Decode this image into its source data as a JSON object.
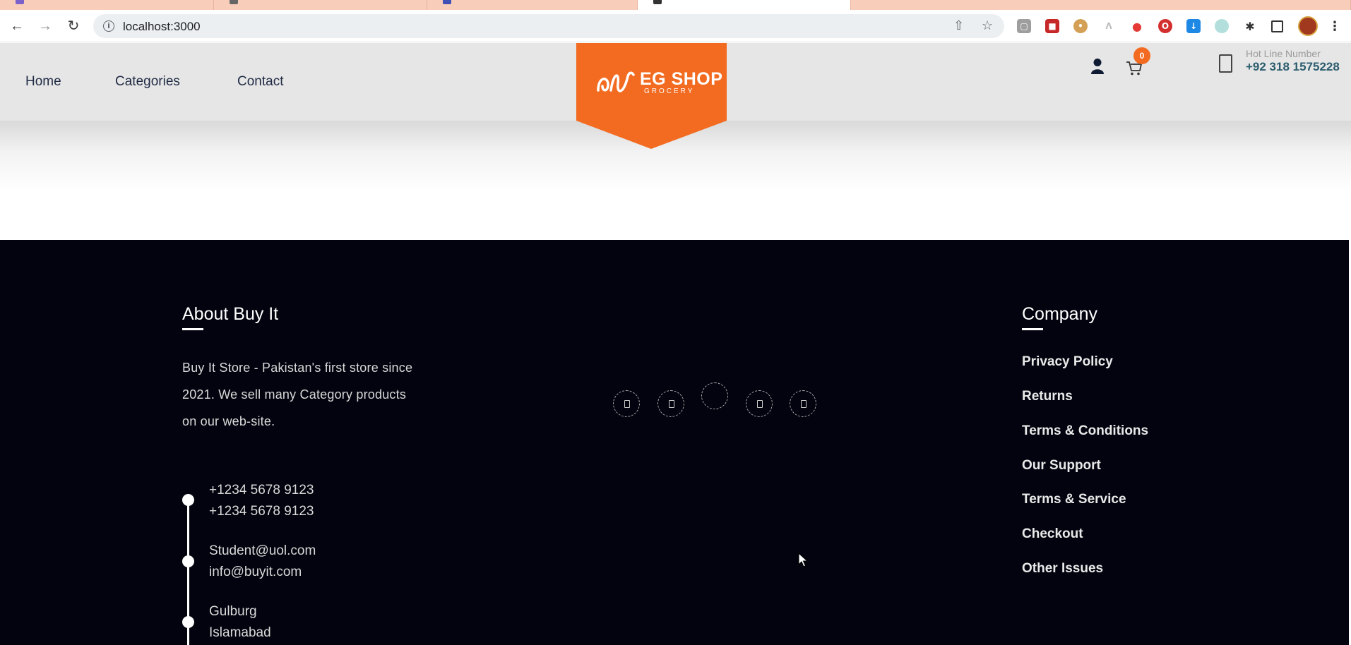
{
  "browser": {
    "url": "localhost:3000"
  },
  "header": {
    "nav": [
      {
        "label": "Home"
      },
      {
        "label": "Categories"
      },
      {
        "label": "Contact"
      }
    ],
    "logo": {
      "title": "EG SHOP",
      "subtitle": "GROCERY"
    },
    "cart_count": "0",
    "hotline": {
      "label": "Hot Line Number",
      "number": "+92 318 1575228"
    }
  },
  "footer": {
    "about": {
      "heading": "About Buy It",
      "description": "Buy It Store - Pakistan's first store since 2021. We sell many Category products on our web-site.",
      "phones": [
        "+1234 5678 9123",
        "+1234 5678 9123"
      ],
      "emails": [
        "Student@uol.com",
        "info@buyit.com"
      ],
      "address": [
        "Gulburg",
        "Islamabad"
      ]
    },
    "company": {
      "heading": "Company",
      "links": [
        {
          "label": "Privacy Policy"
        },
        {
          "label": "Returns"
        },
        {
          "label": "Terms & Conditions"
        },
        {
          "label": "Our Support"
        },
        {
          "label": "Terms & Service"
        },
        {
          "label": "Checkout"
        },
        {
          "label": "Other Issues"
        }
      ]
    }
  },
  "colors": {
    "brand_orange": "#f26b21",
    "footer_bg": "#03030f",
    "header_bg": "#e6e6e6",
    "hotline_text": "#2c5d6e"
  },
  "icons": [
    "back-icon",
    "forward-icon",
    "reload-icon",
    "info-icon",
    "share-icon",
    "star-icon",
    "extensions-icon",
    "sidepanel-icon",
    "menu-icon",
    "user-icon",
    "cart-icon",
    "phone-icon"
  ]
}
